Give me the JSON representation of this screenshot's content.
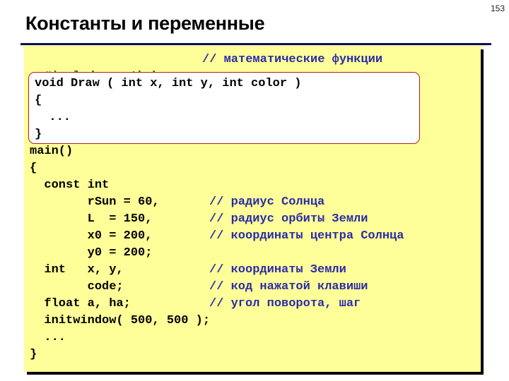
{
  "slide": {
    "page_number": "153",
    "title": "Константы и переменные"
  },
  "code": {
    "include": {
      "directive": "#include <math.h>",
      "comment": "// математические функции"
    },
    "function_box": [
      "void Draw ( int x, int y, int color )",
      "{",
      "  ...",
      "}"
    ],
    "lines": [
      {
        "code": "main()",
        "comment": ""
      },
      {
        "code": "{",
        "comment": ""
      },
      {
        "code": "  const int",
        "comment": ""
      },
      {
        "code": "        rSun = 60,",
        "comment": "// радиус Солнца"
      },
      {
        "code": "        L  = 150,",
        "comment": "// радиус орбиты Земли"
      },
      {
        "code": "        x0 = 200,",
        "comment": "// координаты центра Солнца"
      },
      {
        "code": "        y0 = 200;",
        "comment": ""
      },
      {
        "code": "  int   x, y,",
        "comment": "// координаты Земли"
      },
      {
        "code": "        code;",
        "comment": "// код нажатой клавиши"
      },
      {
        "code": "  float a, ha;",
        "comment": "// угол поворота, шаг"
      },
      {
        "code": "  initwindow( 500, 500 );",
        "comment": ""
      },
      {
        "code": "  ...",
        "comment": ""
      },
      {
        "code": "}",
        "comment": ""
      }
    ]
  },
  "colors": {
    "code_background": "#ffff99",
    "comment": "#2b2ba8",
    "preprocessor": "#1a6e1a",
    "function_box_border": "#b0201a",
    "title_rule": "#0c0c6a"
  }
}
